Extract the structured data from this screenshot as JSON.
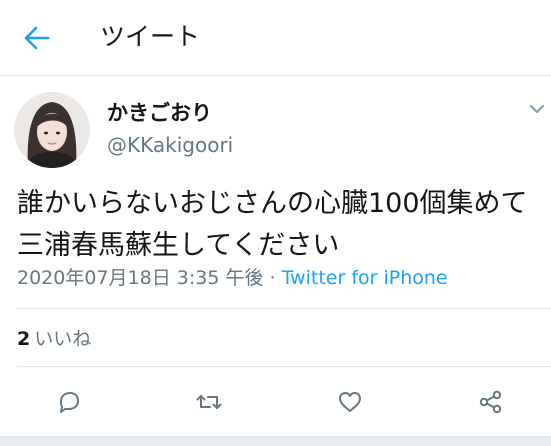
{
  "header": {
    "title": "ツイート",
    "icon": "back-arrow-icon",
    "accent": "#1da1f2"
  },
  "tweet": {
    "author": {
      "display_name": "かきごおり",
      "handle": "@KKakigoori"
    },
    "text": "誰かいらないおじさんの心臓100個集めて三浦春馬蘇生してください",
    "timestamp": "2020年07月18日 3:35 午後",
    "separator": "·",
    "source": "Twitter for iPhone",
    "likes": {
      "count": "2",
      "label": "いいね"
    }
  },
  "actions": [
    "reply-icon",
    "retweet-icon",
    "like-icon",
    "share-icon"
  ]
}
